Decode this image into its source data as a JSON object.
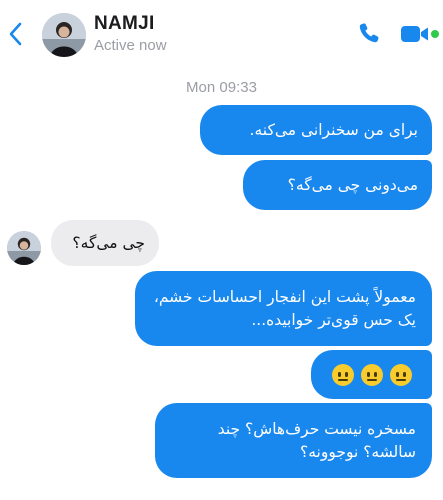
{
  "header": {
    "contact_name": "NAMJI",
    "status": "Active now"
  },
  "colors": {
    "accent": "#1887ee",
    "incoming_bubble": "#ececee",
    "online": "#31c94e"
  },
  "icons": {
    "back": "chevron-left-icon",
    "call": "phone-icon",
    "video": "video-camera-icon",
    "emoji": "neutral-face-emoji"
  },
  "thread": {
    "timestamp": "Mon 09:33",
    "messages": [
      {
        "direction": "outgoing",
        "text": "برای من سخنرانی می‌کنه."
      },
      {
        "direction": "outgoing",
        "text": "می‌دونی چی می‌گه؟"
      },
      {
        "direction": "incoming",
        "text": "چی می‌گه؟"
      },
      {
        "direction": "outgoing",
        "text": "معمولاً پشت این انفجار احساسات خشم، یک حس قوی‌تر خوابیده..."
      },
      {
        "direction": "outgoing",
        "emoji": [
          "😐",
          "😐",
          "😐"
        ]
      },
      {
        "direction": "outgoing",
        "text": "مسخره نیست حرف‌هاش؟ چند سالشه؟ نوجوونه؟"
      }
    ]
  }
}
